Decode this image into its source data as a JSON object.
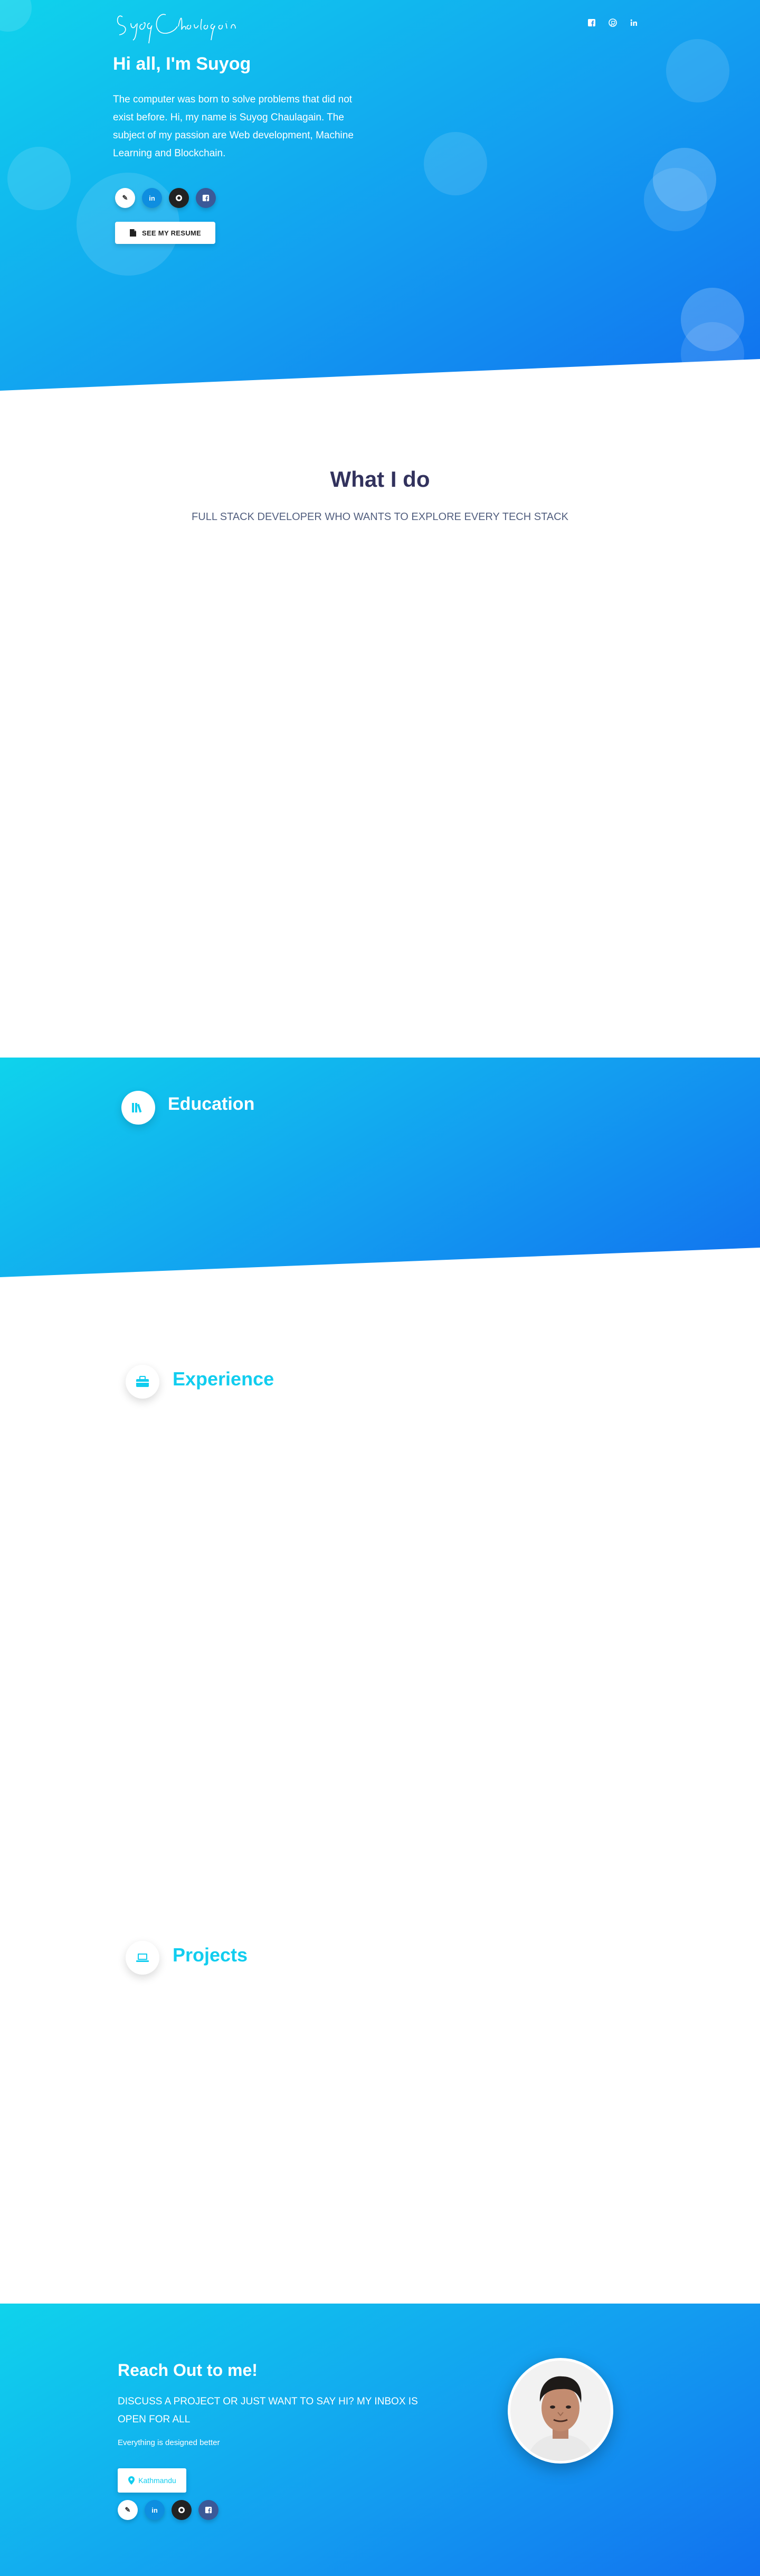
{
  "hero": {
    "logo_text": "Suyog Chaulagain",
    "nav_icons": [
      "facebook-icon",
      "github-icon",
      "linkedin-icon"
    ],
    "title": "Hi all, I'm Suyog",
    "description": "The computer was born to solve problems that did not exist before. Hi, my name is Suyog Chaulagain. The subject of my passion are Web development, Machine Learning and Blockchain.",
    "social": [
      "email-icon",
      "linkedin-icon",
      "github-icon",
      "facebook-icon"
    ],
    "resume_label": "SEE MY RESUME"
  },
  "whatido": {
    "title": "What I do",
    "subtitle": "FULL STACK DEVELOPER WHO WANTS TO EXPLORE EVERY TECH STACK"
  },
  "education": {
    "title": "Education",
    "icon": "books-icon"
  },
  "experience": {
    "title": "Experience",
    "icon": "briefcase-icon"
  },
  "projects": {
    "title": "Projects",
    "icon": "laptop-icon"
  },
  "contact": {
    "title": "Reach Out to me!",
    "subtitle": "DISCUSS A PROJECT OR JUST WANT TO SAY HI? MY INBOX IS OPEN FOR ALL",
    "note": "Everything is designed better",
    "location": "Kathmandu",
    "social": [
      "email-icon",
      "linkedin-icon",
      "github-icon",
      "facebook-icon"
    ]
  },
  "colors": {
    "gradient_start": "#0fd3ec",
    "gradient_end": "#1171ef",
    "accent": "#11cdef",
    "heading": "#32325d"
  }
}
